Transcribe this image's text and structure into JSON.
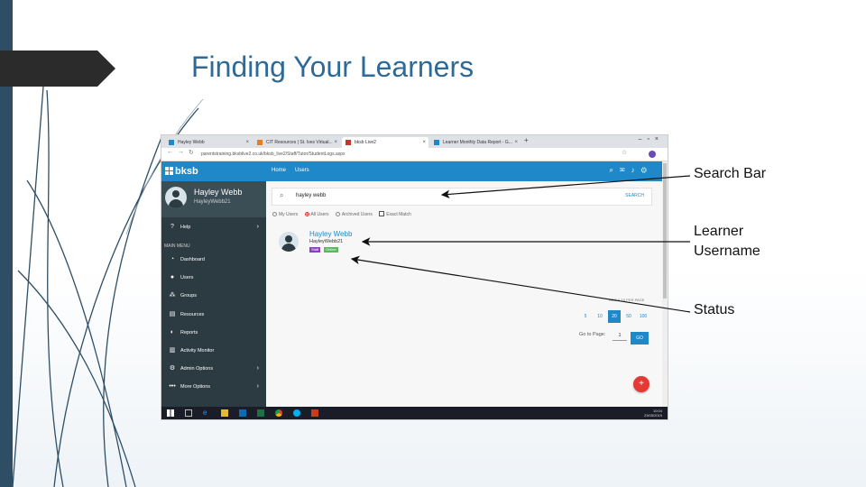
{
  "slide": {
    "title": "Finding Your Learners",
    "callouts": {
      "search_bar": "Search Bar",
      "learner_username_line1": "Learner",
      "learner_username_line2": "Username",
      "status": "Status"
    }
  },
  "browser": {
    "tabs": [
      {
        "label": "Hayley Webb",
        "active": false
      },
      {
        "label": "CIT Resources | St. Ives Virtual...",
        "active": false
      },
      {
        "label": "bksb Live2",
        "active": true
      },
      {
        "label": "Learner Monthly Data Report - G...",
        "active": false
      }
    ],
    "url": "parentstraining.bksblive2.co.uk/bksb_live2/Staff/Tutor/StudentLogs.aspx",
    "controls_icons": [
      "minimize-icon",
      "maximize-icon",
      "close-icon"
    ]
  },
  "app": {
    "logo": "bksb",
    "breadcrumb": [
      "Home",
      "Users"
    ],
    "user_name": "Hayley Webb",
    "user_username": "HayleyWebb21",
    "nav": [
      {
        "label": "Help",
        "icon": "help-icon",
        "chevron": true
      },
      {
        "label": "Dashboard",
        "icon": "dashboard-icon",
        "chevron": false
      },
      {
        "label": "Users",
        "icon": "user-icon",
        "chevron": false
      },
      {
        "label": "Groups",
        "icon": "groups-icon",
        "chevron": false
      },
      {
        "label": "Resources",
        "icon": "resources-icon",
        "chevron": false
      },
      {
        "label": "Reports",
        "icon": "reports-icon",
        "chevron": false
      },
      {
        "label": "Activity Monitor",
        "icon": "activity-icon",
        "chevron": false
      },
      {
        "label": "Admin Options",
        "icon": "admin-icon",
        "chevron": true
      },
      {
        "label": "More Options",
        "icon": "more-icon",
        "chevron": true
      }
    ],
    "main_menu_label": "MAIN MENU",
    "search": {
      "value": "hayley webb",
      "button": "SEARCH"
    },
    "filters": [
      {
        "label": "My Users",
        "selected": false
      },
      {
        "label": "All Users",
        "selected": true
      },
      {
        "label": "Archived Users",
        "selected": false
      }
    ],
    "exact_match_label": "Exact Match",
    "result": {
      "name": "Hayley Webb",
      "username": "HayleyWebb21",
      "badge_staff": "Staff",
      "badge_online": "Online"
    },
    "results_per_page_label": "RESULTS PER PAGE",
    "page_sizes": [
      "5",
      "10",
      "20",
      "50",
      "100"
    ],
    "page_size_selected": "20",
    "goto_label": "Go to Page:",
    "goto_value": "1",
    "go_button": "GO",
    "fab_symbol": "+"
  },
  "taskbar": {
    "time": "10:04",
    "date": "23/05/2019"
  },
  "colors": {
    "accent": "#1e88c9",
    "sidebar": "#2c3b41",
    "title": "#2e6a98",
    "staff_badge": "#8e3fc4",
    "online_badge": "#5cb85c",
    "fab": "#e53935"
  }
}
